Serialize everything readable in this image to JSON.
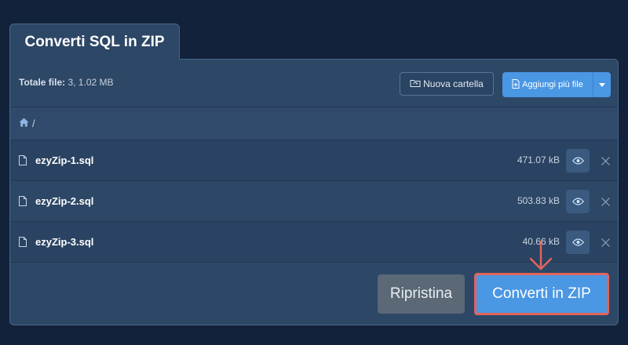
{
  "tab": {
    "label": "Converti SQL in ZIP"
  },
  "toolbar": {
    "total_label": "Totale file:",
    "total_value": "3, 1.02 MB",
    "new_folder_label": "Nuova cartella",
    "add_files_label": "Aggiungi più file"
  },
  "breadcrumb": {
    "path": "/"
  },
  "files": [
    {
      "name": "ezyZip-1.sql",
      "size": "471.07 kB"
    },
    {
      "name": "ezyZip-2.sql",
      "size": "503.83 kB"
    },
    {
      "name": "ezyZip-3.sql",
      "size": "40.66 kB"
    }
  ],
  "footer": {
    "reset_label": "Ripristina",
    "convert_label": "Converti in ZIP"
  },
  "colors": {
    "background": "#11223a",
    "panel": "#2d4766",
    "accent": "#4a97e4",
    "highlight": "#e0655d",
    "reset_button": "#5b6876"
  },
  "icons": [
    "folder-sync-icon",
    "add-file-icon",
    "caret-down-icon",
    "home-icon",
    "file-icon",
    "eye-icon",
    "close-icon",
    "arrow-down-icon"
  ]
}
